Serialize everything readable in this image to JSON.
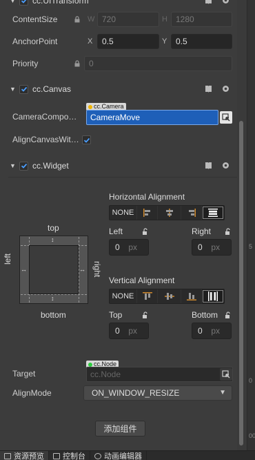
{
  "transform": {
    "title": "cc.UITransform",
    "content_size": {
      "label": "ContentSize",
      "w_axis": "W",
      "w": "720",
      "h_axis": "H",
      "h": "1280"
    },
    "anchor_point": {
      "label": "AnchorPoint",
      "x_axis": "X",
      "x": "0.5",
      "y_axis": "Y",
      "y": "0.5"
    },
    "priority": {
      "label": "Priority",
      "value": "0"
    }
  },
  "canvas": {
    "title": "cc.Canvas",
    "camera_component": {
      "label": "CameraCompo…",
      "type_tag": "cc.Camera",
      "value": "CameraMove"
    },
    "align_canvas_with_screen": {
      "label": "AlignCanvasWit…",
      "checked": true
    }
  },
  "widget": {
    "title": "cc.Widget",
    "preview": {
      "top": "top",
      "bottom": "bottom",
      "left": "left",
      "right": "right"
    },
    "horizontal_alignment": {
      "label": "Horizontal Alignment",
      "none": "NONE",
      "active": "stretch",
      "left_label": "Left",
      "left_value": "0",
      "left_unit": "px",
      "right_label": "Right",
      "right_value": "0",
      "right_unit": "px"
    },
    "vertical_alignment": {
      "label": "Vertical Alignment",
      "none": "NONE",
      "active": "stretch",
      "top_label": "Top",
      "top_value": "0",
      "top_unit": "px",
      "bottom_label": "Bottom",
      "bottom_value": "0",
      "bottom_unit": "px"
    },
    "target": {
      "label": "Target",
      "type_tag": "cc.Node",
      "placeholder": "cc.Node"
    },
    "align_mode": {
      "label": "AlignMode",
      "value": "ON_WINDOW_RESIZE"
    }
  },
  "add_component_button": "添加组件",
  "bottom_tabs": [
    {
      "label": "资源预览",
      "active": true
    },
    {
      "label": "控制台",
      "active": false
    },
    {
      "label": "动画编辑器",
      "active": false
    }
  ],
  "right_strip_marks": [
    "5",
    "0",
    "00"
  ],
  "colors": {
    "accent_blue": "#1e5fb8",
    "checkbox_blue": "#4a9eff",
    "camera_dot": "#f0b400",
    "node_dot": "#2ecc40"
  }
}
